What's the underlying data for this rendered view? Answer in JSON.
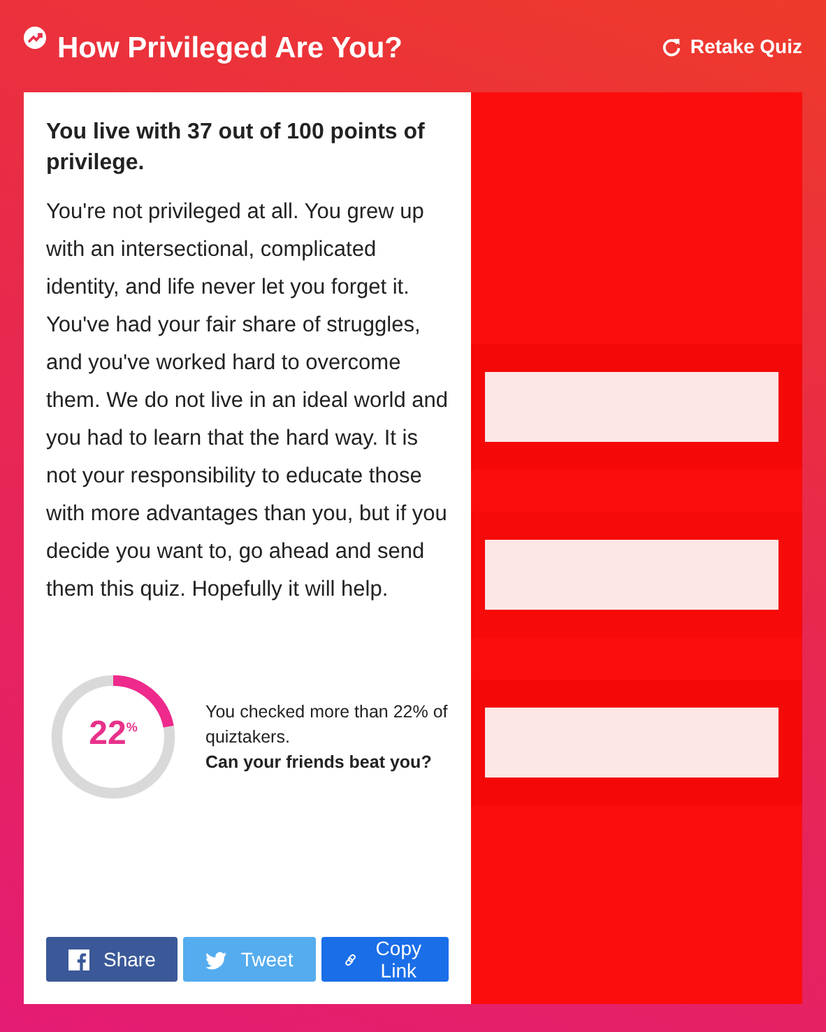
{
  "header": {
    "title": "How Privileged Are You?",
    "action": "Retake Quiz"
  },
  "result": {
    "headline": "You live with 37 out of 100 points of privilege.",
    "description": "You're not privileged at all. You grew up with an intersectional, complicated identity, and life never let you forget it. You've had your fair share of struggles, and you've worked hard to overcome them. We do not live in an ideal world and you had to learn that the hard way. It is not your responsibility to educate those with more advantages than you, but if you decide you want to, go ahead and send them this quiz. Hopefully it will help."
  },
  "stat": {
    "level": 0.22,
    "value": "22$^{%}$",
    "line": "You checked more than 22% of quiztakers.",
    "challenge": "Can your friends beat you?"
  },
  "share_buttons": [
    {
      "kind": "facebook",
      "label": "Share"
    },
    {
      "kind": "twitter",
      "label": "Tweet"
    },
    {
      "kind": "link",
      "label": "Copy Link"
    }
  ]
}
